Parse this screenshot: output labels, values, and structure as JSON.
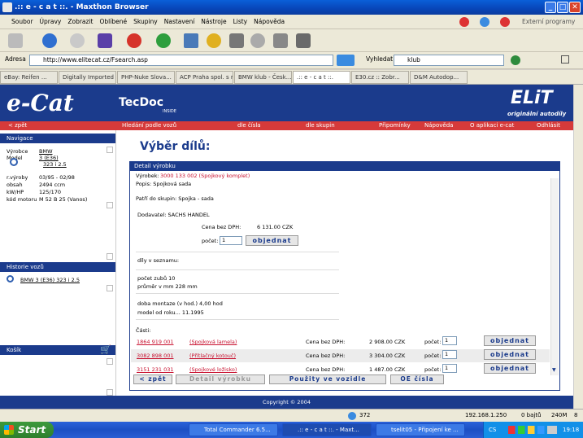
{
  "window": {
    "title": ".:: e - c a t ::. - Maxthon Browser"
  },
  "menu": [
    "Soubor",
    "Úpravy",
    "Zobrazit",
    "Oblíbené",
    "Skupiny",
    "Nastavení",
    "Nástroje",
    "Listy",
    "Nápověda"
  ],
  "menu_right": "Externí programy",
  "address": {
    "label": "Adresa",
    "url": "http://www.elitecat.cz/Fsearch.asp"
  },
  "search": {
    "label": "Vyhledat",
    "value": "klub"
  },
  "tabs": [
    "eBay: Reifen ...",
    "Digitally Imported I",
    "PHP-Nuke Slova...",
    "ACP Praha spol. s r.",
    "BMW klub - Česk...",
    ".:: e - c a t ::.",
    "E30.cz :: Zobr...",
    "D&M Autodop..."
  ],
  "site": {
    "logo": "e-Cat",
    "tecdoc": "TecDoc",
    "tecdoc_sub": "INSIDE",
    "elit": "ELiT",
    "elit_sub": "originální autodíly",
    "nav": [
      "< zpět",
      "Hledání podle vozů",
      "dle čísla",
      "dle skupin",
      "Připomínky",
      "Nápověda",
      "O aplikaci e-cat",
      "Odhlásit"
    ]
  },
  "sidebar": {
    "nav_title": "Navigace",
    "vehicle": [
      {
        "k": "Výrobce",
        "v": "BMW"
      },
      {
        "k": "Model",
        "v": "3 (E36)"
      },
      {
        "k": "",
        "v": "323 i 2.5"
      },
      {
        "k": "r.výroby",
        "v": "03/95 - 02/98"
      },
      {
        "k": "obsah",
        "v": "2494 ccm"
      },
      {
        "k": "kW/HP",
        "v": "125/170"
      },
      {
        "k": "kód motoru",
        "v": "M 52 B 25 (Vanos)"
      }
    ],
    "history_title": "Historie vozů",
    "history_item": "BMW 3 (E36) 323 i 2.5",
    "cart_title": "Košík"
  },
  "main": {
    "title": "Výběr dílů:",
    "detail_title": "Detail výrobku",
    "product_label": "Výrobek:",
    "product_value": "3000 133 002 (Spojkový komplet)",
    "desc": "Popis: Spojková sada",
    "group": "Patří do skupin: Spojka - sada",
    "supplier": "Dodavatel: SACHS HANDEL",
    "price_label": "Cena bez DPH:",
    "price_value": "6 131.00 CZK",
    "qty_label": "počet:",
    "qty_value": "1",
    "order_label": "objednat",
    "parts_in_list": "díly v seznamu:",
    "spec1": "počet zubů    10",
    "spec2": "průměr v mm    228 mm",
    "spec3": "doba montaze (v hod.)    4,00 hod",
    "spec4": "model od roku...    11.1995",
    "parts_title": "Části:",
    "parts": [
      {
        "code": "1864 919 001",
        "name": "(Spojková lamela)",
        "price": "2 908.00 CZK",
        "qty": "1"
      },
      {
        "code": "3082 898 001",
        "name": "(Přítlačný kotouč)",
        "price": "3 304.00 CZK",
        "qty": "1"
      },
      {
        "code": "3151 231 031",
        "name": "(Spojkové ložisko)",
        "price": "1 487.00 CZK",
        "qty": "1"
      }
    ],
    "buttons": [
      "< zpět",
      "Detail výrobku",
      "Použity ve vozidle",
      "OE čísla"
    ],
    "copyright": "Copyright © 2004"
  },
  "status": {
    "count": "372",
    "ip": "192.168.1.250",
    "bytes": "0 bajtů",
    "mem": "240M",
    "num": "8"
  },
  "taskbar": {
    "start": "Start",
    "tasks": [
      "Total Commander 6.5...",
      ".:: e - c a t ::. - Maxt...",
      "tselit05 - Připojení ke ..."
    ],
    "lang": "CS",
    "time": "19:18"
  }
}
